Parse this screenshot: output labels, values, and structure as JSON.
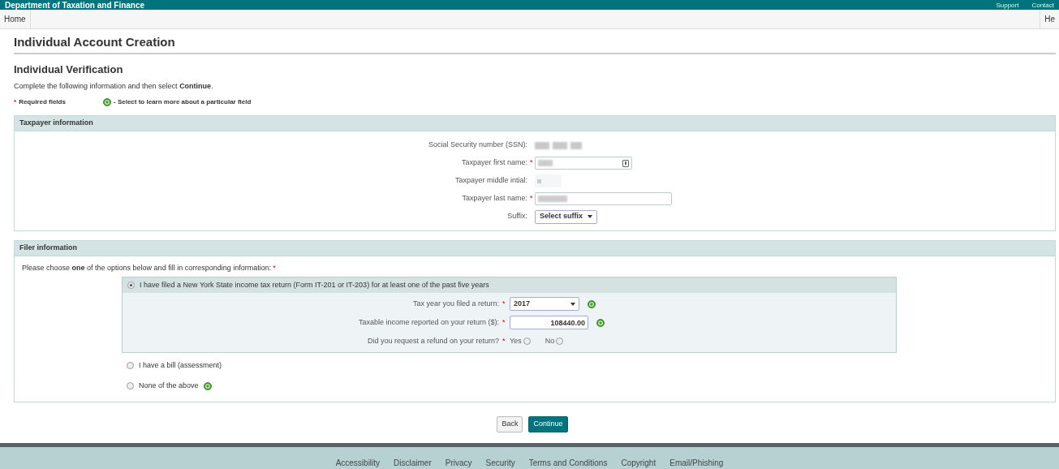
{
  "header": {
    "title": "Department of Taxation and Finance",
    "links": [
      "Support",
      "Contact"
    ]
  },
  "nav": {
    "items": [
      {
        "label": "Home"
      },
      {
        "label": "He"
      }
    ]
  },
  "page_title": "Individual Account Creation",
  "section_title": "Individual Verification",
  "instructions": "Complete the following information and then select **Continue**.",
  "legend": {
    "required_mark": "*",
    "required": "Required fields",
    "help": "- Select to learn more about a particular field"
  },
  "taxpayer": {
    "title": "Taxpayer information",
    "fields": [
      {
        "label": "Social Security number (SSN):",
        "kind": "redacted"
      },
      {
        "label": "Taxpayer first name:",
        "required_mark": "*",
        "kind": "redacted-input"
      },
      {
        "label": "Taxpayer middle intial:",
        "kind": "redacted-small"
      },
      {
        "label": "Taxpayer last name:",
        "required_mark": "*",
        "kind": "redacted-wide"
      },
      {
        "label": "Suffix:",
        "kind": "select",
        "value": "Select suffix"
      }
    ]
  },
  "filer": {
    "title": "Filer information",
    "prompt": "Please choose **one** of the options below and fill in corresponding information:",
    "required_mark": "*",
    "options": [
      {
        "label": "I have filed a New York State income tax return (Form IT-201 or IT-203) for at least one of the past five years",
        "selected": true,
        "help": false,
        "fields": [
          {
            "label": "Tax year you filed a return:",
            "required_mark": "*",
            "kind": "select",
            "value": "2017",
            "help": true
          },
          {
            "label": "Taxable income reported on your return ($):",
            "required_mark": "*",
            "kind": "amount",
            "value": "108440.00",
            "help": true
          },
          {
            "label": "Did you request a refund on your return?",
            "required_mark": "*",
            "help": false,
            "kind": "radios",
            "choices": [
              {
                "label": "Yes",
                "selected": false
              },
              {
                "label": "No",
                "selected": false
              }
            ]
          }
        ]
      },
      {
        "label": "I have a bill (assessment)",
        "selected": false,
        "help": false
      },
      {
        "label": "None of the above",
        "selected": false,
        "help": true
      }
    ]
  },
  "buttons": [
    {
      "label": "Back",
      "kind": "secondary"
    },
    {
      "label": "Continue",
      "kind": "primary"
    }
  ],
  "footer": {
    "links": [
      "Accessibility",
      "Disclaimer",
      "Privacy",
      "Security",
      "Terms and Conditions",
      "Copyright",
      "Email/Phishing"
    ]
  }
}
